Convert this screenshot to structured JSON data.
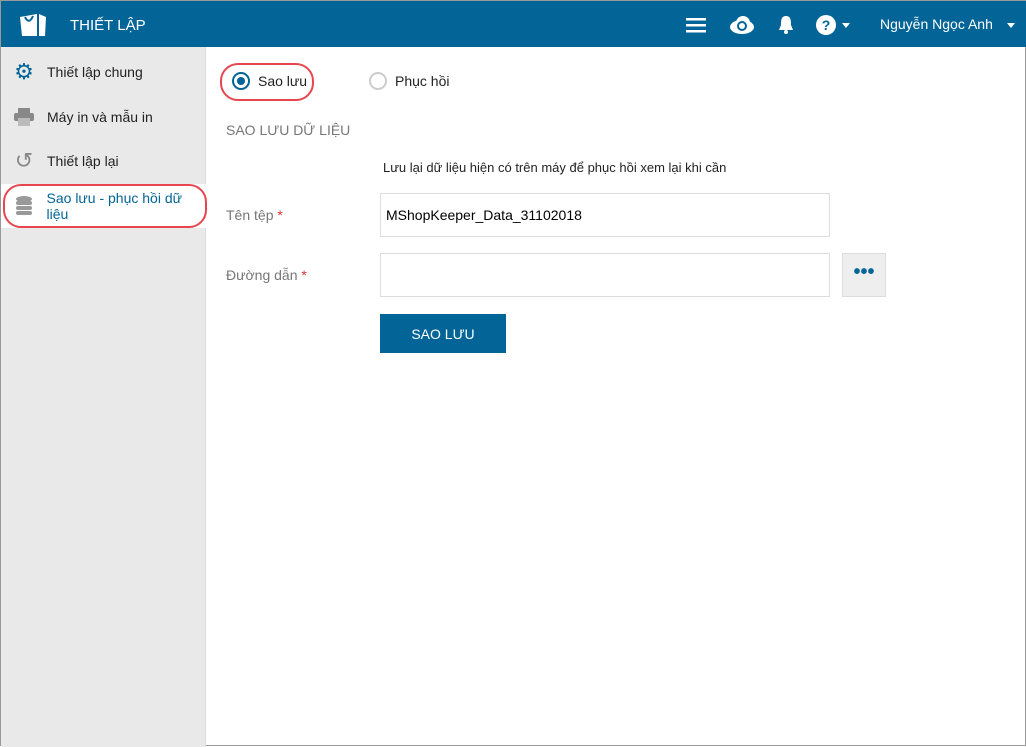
{
  "header": {
    "title": "THIẾT LẬP",
    "user": "Nguyễn Ngọc Anh"
  },
  "sidebar": {
    "items": [
      {
        "label": "Thiết lập chung"
      },
      {
        "label": "Máy in và mẫu in"
      },
      {
        "label": "Thiết lập lại"
      },
      {
        "label": "Sao lưu - phục hồi dữ liệu"
      }
    ]
  },
  "main": {
    "radio_backup": "Sao lưu",
    "radio_restore": "Phục hồi",
    "section": "SAO LƯU DỮ LIỆU",
    "description": "Lưu lại dữ liệu hiện có trên máy để phục hồi xem lại khi cần",
    "filename_label": "Tên tệp",
    "filename_value": "MShopKeeper_Data_31102018",
    "path_label": "Đường dẫn",
    "path_value": "",
    "required": "*",
    "browse": "•••",
    "submit": "SAO LƯU"
  }
}
